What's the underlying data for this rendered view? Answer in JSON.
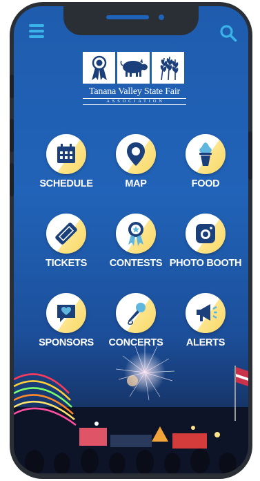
{
  "logo": {
    "title": "Tanana Valley State Fair",
    "subtitle": "ASSOCIATION"
  },
  "tiles": [
    {
      "label": "SCHEDULE",
      "icon": "calendar-icon"
    },
    {
      "label": "MAP",
      "icon": "map-pin-icon"
    },
    {
      "label": "FOOD",
      "icon": "ice-cream-icon"
    },
    {
      "label": "TICKETS",
      "icon": "ticket-icon"
    },
    {
      "label": "CONTESTS",
      "icon": "ribbon-icon"
    },
    {
      "label": "PHOTO BOOTH",
      "icon": "camera-icon"
    },
    {
      "label": "SPONSORS",
      "icon": "heart-chat-icon"
    },
    {
      "label": "CONCERTS",
      "icon": "microphone-icon"
    },
    {
      "label": "ALERTS",
      "icon": "megaphone-icon"
    }
  ],
  "colors": {
    "background": "#1f5cae",
    "icon_navy": "#1b3f7a",
    "accent_yellow": "#f7d766",
    "header_icons": "#39b3e8"
  }
}
